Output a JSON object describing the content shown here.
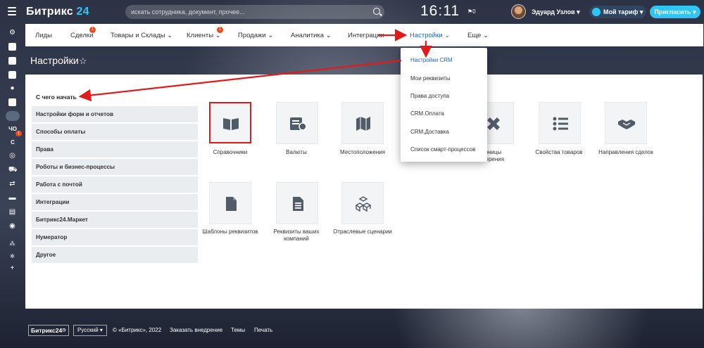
{
  "header": {
    "brand_name": "Битрикс",
    "brand_num": "24",
    "search_placeholder": "искать сотрудника, документ, прочее...",
    "clock": "16:11",
    "flag_count": "0",
    "user_name": "Эдуард Узлов",
    "tariff_label": "Мой тариф",
    "invite_label": "Пригласить"
  },
  "rail": {
    "badge": "1",
    "short_1": "ЧО",
    "short_2": "С"
  },
  "nav": {
    "items": [
      {
        "label": "Лиды"
      },
      {
        "label": "Сделки",
        "count": "1"
      },
      {
        "label": "Товары и Склады"
      },
      {
        "label": "Клиенты",
        "count": "1"
      },
      {
        "label": "Продажи"
      },
      {
        "label": "Аналитика"
      },
      {
        "label": "Интеграции"
      },
      {
        "label": "Настройки"
      },
      {
        "label": "Еще"
      }
    ]
  },
  "page": {
    "title": "Настройки",
    "start_heading": "С чего начать"
  },
  "sidebar_menu": [
    "Настройки форм и отчетов",
    "Способы оплаты",
    "Права",
    "Роботы и бизнес-процессы",
    "Работа с почтой",
    "Интеграции",
    "Битрикс24.Маркет",
    "Нумератор",
    "Другое"
  ],
  "tiles": {
    "row1": [
      {
        "label": "Справочники",
        "icon": "book-icon"
      },
      {
        "label": "Валюты",
        "icon": "currency-icon"
      },
      {
        "label": "Местоположения",
        "icon": "map-icon"
      },
      {
        "label": "Единицы измерения",
        "icon": "ruler-icon",
        "partial": "диницы\nмерения"
      },
      {
        "label": "Свойства товаров",
        "icon": "list-icon"
      },
      {
        "label": "Направления сделок",
        "icon": "handshake-icon"
      }
    ],
    "row2": [
      {
        "label": "Шаблоны реквизитов",
        "icon": "file-icon"
      },
      {
        "label": "Реквизиты ваших компаний",
        "icon": "document-icon"
      },
      {
        "label": "Отраслевые сценарии",
        "icon": "cubes-icon"
      }
    ]
  },
  "dropdown": [
    "Настройки CRM",
    "Мои реквизиты",
    "Права доступа",
    "CRM.Оплата",
    "CRM.Доставка",
    "Список смарт-процессов"
  ],
  "footer": {
    "brand": "Битрикс24",
    "lang": "Русский",
    "copyright": "© «Битрикс», 2022",
    "order": "Заказать внедрение",
    "themes": "Темы",
    "print": "Печать"
  },
  "colors": {
    "accent": "#2fc6f6",
    "link_active": "#2067b0",
    "annotation_red": "#e01b1b",
    "badge": "#f54819"
  }
}
